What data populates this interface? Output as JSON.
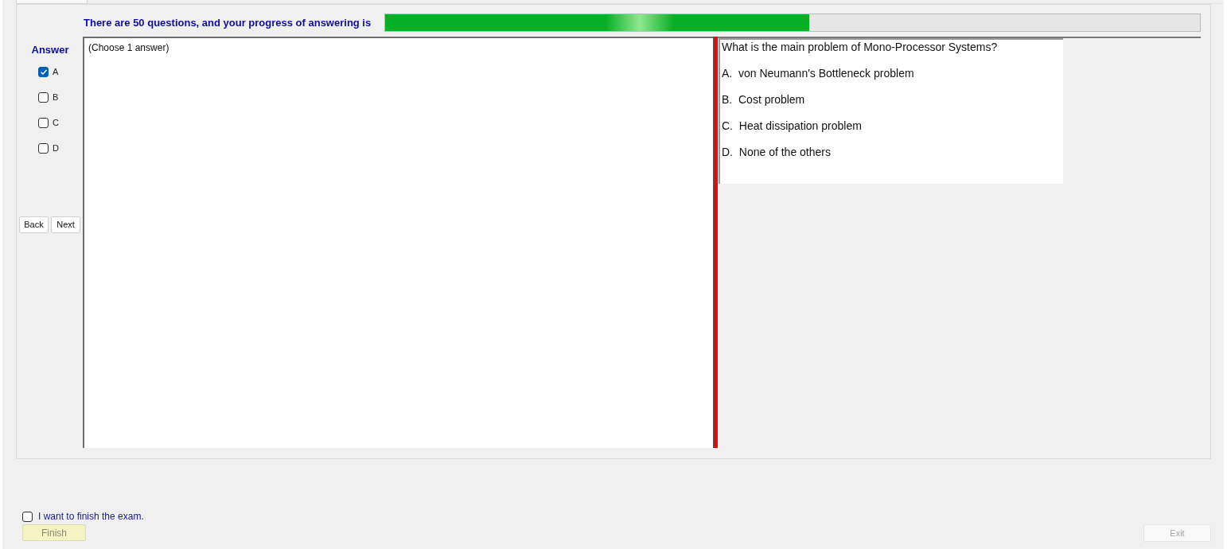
{
  "header": {
    "text": "There are 50 questions, and your progress of answering is",
    "progress": {
      "level": 0.52
    }
  },
  "answer_panel": {
    "title": "Answer",
    "options": [
      {
        "label": "A",
        "checked": true
      },
      {
        "label": "B",
        "checked": false
      },
      {
        "label": "C",
        "checked": false
      },
      {
        "label": "D",
        "checked": false
      }
    ],
    "buttons": [
      "Back",
      "Next"
    ]
  },
  "question_hint": "(Choose 1 answer)",
  "question": {
    "text": "What is the main problem of Mono-Processor Systems?",
    "choices": [
      "A.  von Neumann's Bottleneck problem",
      "B.  Cost problem",
      "C.  Heat dissipation problem",
      "D.  None of the others"
    ]
  },
  "finish": {
    "label": "I want to finish the exam.",
    "checked": false,
    "button": {
      "label": "Finish",
      "disabled": true
    }
  },
  "exit_button": {
    "label": "Exit",
    "disabled": true
  }
}
